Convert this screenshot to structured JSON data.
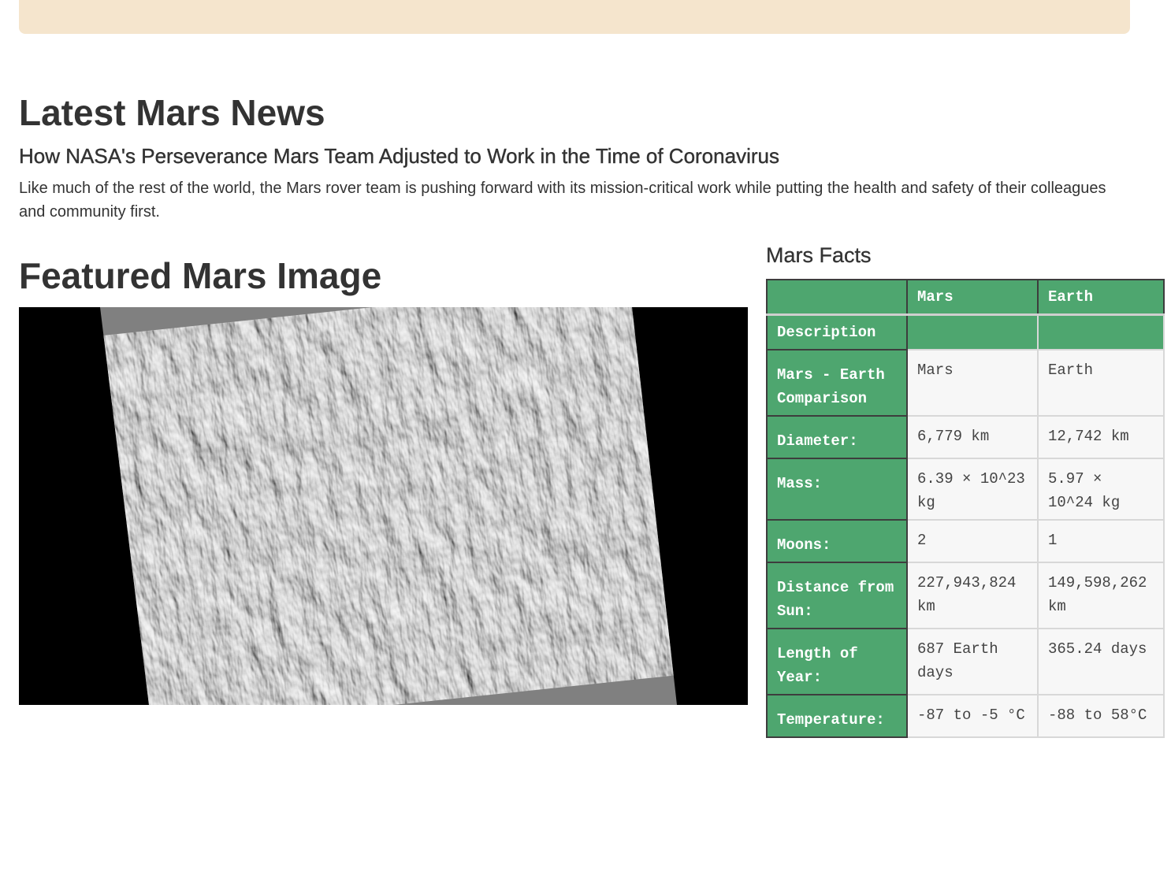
{
  "news": {
    "heading": "Latest Mars News",
    "title": "How NASA's Perseverance Mars Team Adjusted to Work in the Time of Coronavirus",
    "body": "Like much of the rest of the world, the Mars rover team is pushing forward with its mission-critical work while putting the health and safety of their colleagues and community first."
  },
  "featured": {
    "heading": "Featured Mars Image",
    "image_alt": "Mars surface dunes grayscale image"
  },
  "facts": {
    "heading": "Mars Facts",
    "columns": [
      "",
      "Mars",
      "Earth"
    ],
    "description_label": "Description",
    "rows": [
      {
        "label": "Mars - Earth Comparison",
        "mars": "Mars",
        "earth": "Earth"
      },
      {
        "label": "Diameter:",
        "mars": "6,779 km",
        "earth": "12,742 km"
      },
      {
        "label": "Mass:",
        "mars": "6.39 × 10^23 kg",
        "earth": "5.97 × 10^24 kg"
      },
      {
        "label": "Moons:",
        "mars": "2",
        "earth": "1"
      },
      {
        "label": "Distance from Sun:",
        "mars": "227,943,824 km",
        "earth": "149,598,262 km"
      },
      {
        "label": "Length of Year:",
        "mars": "687 Earth days",
        "earth": "365.24 days"
      },
      {
        "label": "Temperature:",
        "mars": "-87 to -5 °C",
        "earth": "-88 to 58°C"
      }
    ]
  },
  "colors": {
    "banner": "#f5e5cd",
    "table_header": "#4ea66f",
    "table_cell": "#f7f7f7"
  }
}
